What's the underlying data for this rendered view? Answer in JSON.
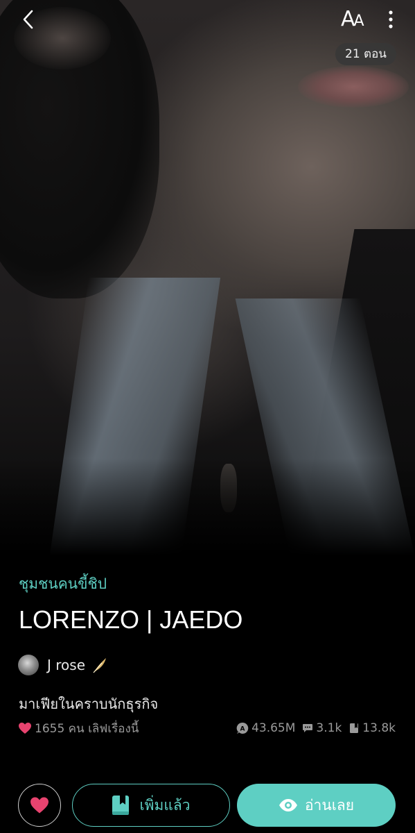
{
  "header": {
    "back_icon": "chevron-left-icon",
    "font_size_label_big": "A",
    "font_size_label_small": "A",
    "more_icon": "vertical-dots-icon",
    "episodes_badge": "21 ตอน"
  },
  "cover": {
    "icon": "cover-image"
  },
  "story": {
    "category": "ชุมชนคนขี้ชิป",
    "title": "LORENZO | JAEDO",
    "author": "J rose",
    "author_badge_icon": "feather-icon",
    "tagline": "มาเฟียในคราบนักธุรกิจ"
  },
  "stats": {
    "likes_text": "1655 คน เลิฟเรื่องนี้",
    "views": "43.65M",
    "comments": "3.1k",
    "bookmarks": "13.8k"
  },
  "actions": {
    "heart_icon": "heart-icon",
    "added_label": "เพิ่มแล้ว",
    "read_label": "อ่านเลย"
  },
  "colors": {
    "accent": "#5ecfc3",
    "heart": "#e8436f",
    "background": "#000000"
  }
}
